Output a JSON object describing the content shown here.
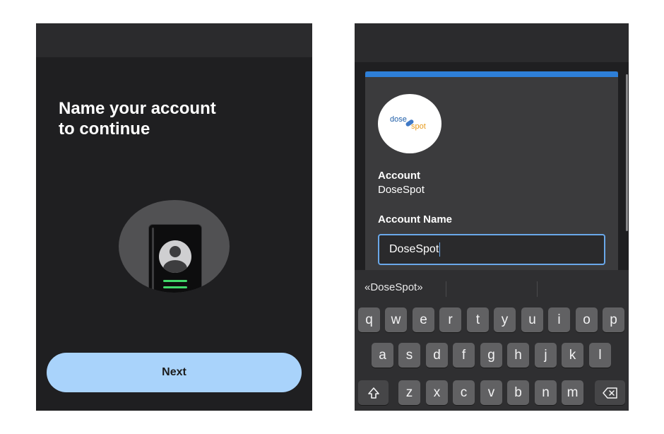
{
  "left_screen": {
    "title_lines": [
      "Name your account",
      "to continue"
    ],
    "next_button": "Next"
  },
  "right_screen": {
    "logo": {
      "part1": "dose",
      "part2": "spot"
    },
    "account_label": "Account",
    "account_value": "DoseSpot",
    "account_name_label": "Account Name",
    "account_name_value": "DoseSpot",
    "accent_color": "#2e7fd8",
    "keyboard": {
      "suggestion": "«DoseSpot»",
      "row1": [
        "q",
        "w",
        "e",
        "r",
        "t",
        "y",
        "u",
        "i",
        "o",
        "p"
      ],
      "row2": [
        "a",
        "s",
        "d",
        "f",
        "g",
        "h",
        "j",
        "k",
        "l"
      ],
      "row3": [
        "z",
        "x",
        "c",
        "v",
        "b",
        "n",
        "m"
      ],
      "shift_icon": "shift-icon",
      "backspace_icon": "backspace-icon"
    }
  }
}
